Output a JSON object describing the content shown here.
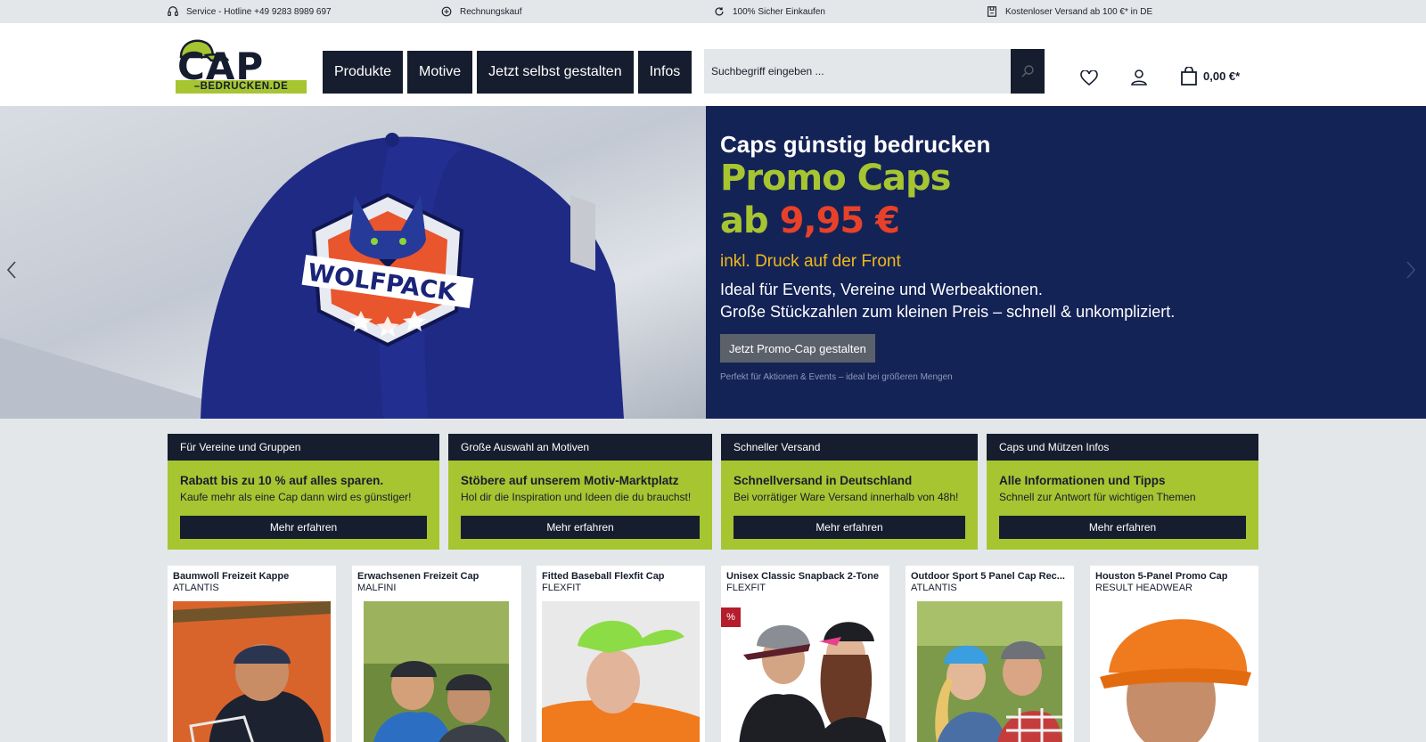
{
  "topbar": {
    "hotline": "Service - Hotline +49 9283 8989 697",
    "invoice": "Rechnungskauf",
    "secure": "100% Sicher Einkaufen",
    "shipping": "Kostenloser Versand ab 100 €* in DE",
    "icons": [
      "headset-icon",
      "payment-icon",
      "refresh-icon",
      "shipping-icon"
    ]
  },
  "header": {
    "logo": {
      "main": "CAP",
      "domain": "–BEDRUCKEN.DE"
    },
    "nav": [
      "Produkte",
      "Motive",
      "Jetzt selbst gestalten",
      "Infos"
    ],
    "search": {
      "placeholder": "Suchbegriff eingeben ..."
    },
    "cart_total": "0,00 €*"
  },
  "hero": {
    "title": "Caps günstig bedrucken",
    "promo": "Promo Caps",
    "price_prefix": "ab",
    "price": "9,95 €",
    "subtitle": "inkl. Druck auf der Front",
    "desc_line1": "Ideal für Events, Vereine und Werbeaktionen.",
    "desc_line2": "Große Stückzahlen zum kleinen Preis – schnell & unkompliziert.",
    "button": "Jetzt Promo-Cap gestalten",
    "note": "Perfekt für Aktionen & Events – ideal bei größeren Mengen",
    "image_logo_text": "WOLFPACK"
  },
  "info_boxes": [
    {
      "header": "Für Vereine und Gruppen",
      "title": "Rabatt bis zu 10 % auf alles sparen.",
      "text": "Kaufe mehr als eine Cap dann wird es günstiger!",
      "button": "Mehr erfahren"
    },
    {
      "header": "Große Auswahl an Motiven",
      "title": "Stöbere auf unserem Motiv-Marktplatz",
      "text": "Hol dir die Inspiration und Ideen die du brauchst!",
      "button": "Mehr erfahren"
    },
    {
      "header": "Schneller Versand",
      "title": "Schnellversand in Deutschland",
      "text": "Bei vorrätiger Ware Versand innerhalb von 48h!",
      "button": "Mehr erfahren"
    },
    {
      "header": "Caps und Mützen Infos",
      "title": "Alle Informationen und Tipps",
      "text": "Schnell zur Antwort für wichtigen Themen",
      "button": "Mehr erfahren"
    }
  ],
  "products": [
    {
      "name": "Baumwoll Freizeit Kappe",
      "brand": "ATLANTIS"
    },
    {
      "name": "Erwachsenen Freizeit Cap",
      "brand": "MALFINI"
    },
    {
      "name": "Fitted Baseball Flexfit Cap",
      "brand": "FLEXFIT"
    },
    {
      "name": "Unisex Classic Snapback 2-Tone",
      "brand": "FLEXFIT",
      "badge": "%"
    },
    {
      "name": "Outdoor Sport 5 Panel Cap Rec...",
      "brand": "ATLANTIS"
    },
    {
      "name": "Houston 5-Panel Promo Cap",
      "brand": "RESULT HEADWEAR"
    }
  ],
  "colors": {
    "navy": "#161d2e",
    "lime": "#a6c531",
    "hero_bg": "#142356",
    "price_red": "#e8412a",
    "subtitle_yellow": "#f0b91a"
  }
}
